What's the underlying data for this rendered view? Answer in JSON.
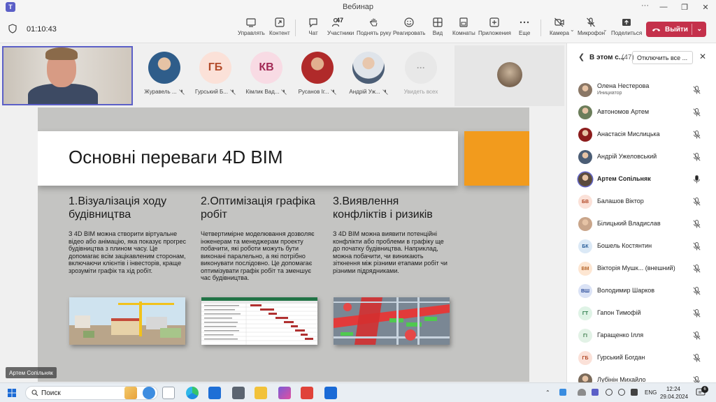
{
  "window": {
    "title": "Вебинар",
    "logo_letter": "T",
    "controls": {
      "more": "···",
      "minimize": "—",
      "restore": "❐",
      "close": "✕"
    }
  },
  "toolbar": {
    "timer": "01:10:43",
    "buttons": {
      "manage": "Управлять",
      "content": "Контент",
      "chat": "Чат",
      "participants": "Участники",
      "participants_count": "47",
      "raise_hand": "Поднять руку",
      "react": "Реагировать",
      "view": "Вид",
      "rooms": "Комнаты",
      "apps": "Приложения",
      "more": "Еще",
      "camera": "Камера",
      "mic": "Микрофон",
      "share": "Поделиться"
    },
    "leave": "Выйти"
  },
  "gallery": {
    "participants": [
      {
        "name": "Журавель ...",
        "initials": "",
        "photo": true,
        "color": "#2f5d8a"
      },
      {
        "name": "Гурський Б...",
        "initials": "ГБ",
        "photo": false,
        "bg": "#fbe1d8",
        "fg": "#b34b2a"
      },
      {
        "name": "Кімлик Вад...",
        "initials": "КВ",
        "photo": false,
        "bg": "#f8dbe4",
        "fg": "#a22a55"
      },
      {
        "name": "Русанов Іг...",
        "initials": "",
        "photo": true,
        "color": "#b02a2a"
      },
      {
        "name": "Андрій Уж...",
        "initials": "",
        "photo": true,
        "color": "#4b5d75"
      }
    ],
    "see_all": "Увидеть всех",
    "see_all_glyph": "···"
  },
  "slide": {
    "title": "Основні переваги 4D BIM",
    "columns": [
      {
        "heading": "1.Візуалізація ходу будівництва",
        "body": "З 4D BIM можна створити віртуальне відео або анімацію, яка показує прогрес будівництва з плином часу. Це допомагає всім зацікавленим сторонам, включаючи клієнтів і інвесторів, краще зрозуміти графік та хід робіт."
      },
      {
        "heading": "2.Оптимізація графіка робіт",
        "body": "Четвертимірне моделювання дозволяє інженерам та менеджерам проекту побачити, які роботи можуть бути виконані паралельно, а які потрібно виконувати послідовно. Це допомагає оптимізувати графік робіт та зменшує час будівництва."
      },
      {
        "heading": "3.Виявлення конфліктів і ризиків",
        "body": "З 4D BIM можна виявити потенційні конфлікти або проблеми в графіку ще до початку будівництва. Наприклад, можна побачити, чи виникають зіткнення між різними етапами робіт чи різними підрядниками."
      }
    ]
  },
  "speaker_label": "Артем Сопільняк",
  "panel": {
    "title": "В этом с...",
    "count": "(47)",
    "mute_all": "Отключить все ...",
    "back_glyph": "❮",
    "close_glyph": "✕",
    "people": [
      {
        "name": "Олена Нестерова",
        "role": "Инициатор",
        "initials": "",
        "photo": true,
        "color": "#8a7766",
        "mic": "off"
      },
      {
        "name": "Автономов Артем",
        "role": "",
        "initials": "",
        "photo": true,
        "color": "#6b7d5a",
        "mic": "off"
      },
      {
        "name": "Анастасія Мислицька",
        "role": "",
        "initials": "",
        "photo": true,
        "color": "#8c1c1c",
        "mic": "off"
      },
      {
        "name": "Андрій Ужеловський",
        "role": "",
        "initials": "",
        "photo": true,
        "color": "#4b5d75",
        "mic": "off"
      },
      {
        "name": "Артем Сопільняк",
        "role": "",
        "initials": "",
        "photo": true,
        "color": "#5a4a3c",
        "mic": "on"
      },
      {
        "name": "Балашов Віктор",
        "role": "",
        "initials": "БВ",
        "photo": false,
        "bg": "#fbe1d8",
        "fg": "#b34b2a",
        "mic": "off"
      },
      {
        "name": "Білицький Владислав",
        "role": "",
        "initials": "",
        "photo": true,
        "color": "#c9a58a",
        "mic": "off"
      },
      {
        "name": "Бошель Костянтин",
        "role": "",
        "initials": "БК",
        "photo": false,
        "bg": "#dbe9f6",
        "fg": "#2a5f9a",
        "mic": "off"
      },
      {
        "name": "Вікторія Мушк... (внешний)",
        "role": "",
        "initials": "ВМ",
        "photo": false,
        "bg": "#fde6d2",
        "fg": "#b5652a",
        "mic": "off"
      },
      {
        "name": "Володимир Шарков",
        "role": "",
        "initials": "ВШ",
        "photo": false,
        "bg": "#dbe3f6",
        "fg": "#2a4b9a",
        "mic": "off"
      },
      {
        "name": "Гапон Тимофій",
        "role": "",
        "initials": "ГТ",
        "photo": false,
        "bg": "#dff3e6",
        "fg": "#2a7a4a",
        "mic": "off"
      },
      {
        "name": "Гаращенко Ілля",
        "role": "",
        "initials": "ГІ",
        "photo": false,
        "bg": "#e2f2e6",
        "fg": "#3a7a4a",
        "mic": "off"
      },
      {
        "name": "Гурський Богдан",
        "role": "",
        "initials": "ГБ",
        "photo": false,
        "bg": "#fbe1d8",
        "fg": "#b34b2a",
        "mic": "off"
      },
      {
        "name": "Лубінін Михайло",
        "role": "",
        "initials": "",
        "photo": true,
        "color": "#7a6a5a",
        "mic": "off"
      }
    ]
  },
  "taskbar": {
    "search": "Поиск",
    "lang": "ENG",
    "time": "12:24",
    "date": "29.04.2024",
    "notif_count": "6"
  },
  "colors": {
    "accent": "#5b5fc7",
    "leave": "#c4314b",
    "slide_orange": "#f29b1d"
  }
}
